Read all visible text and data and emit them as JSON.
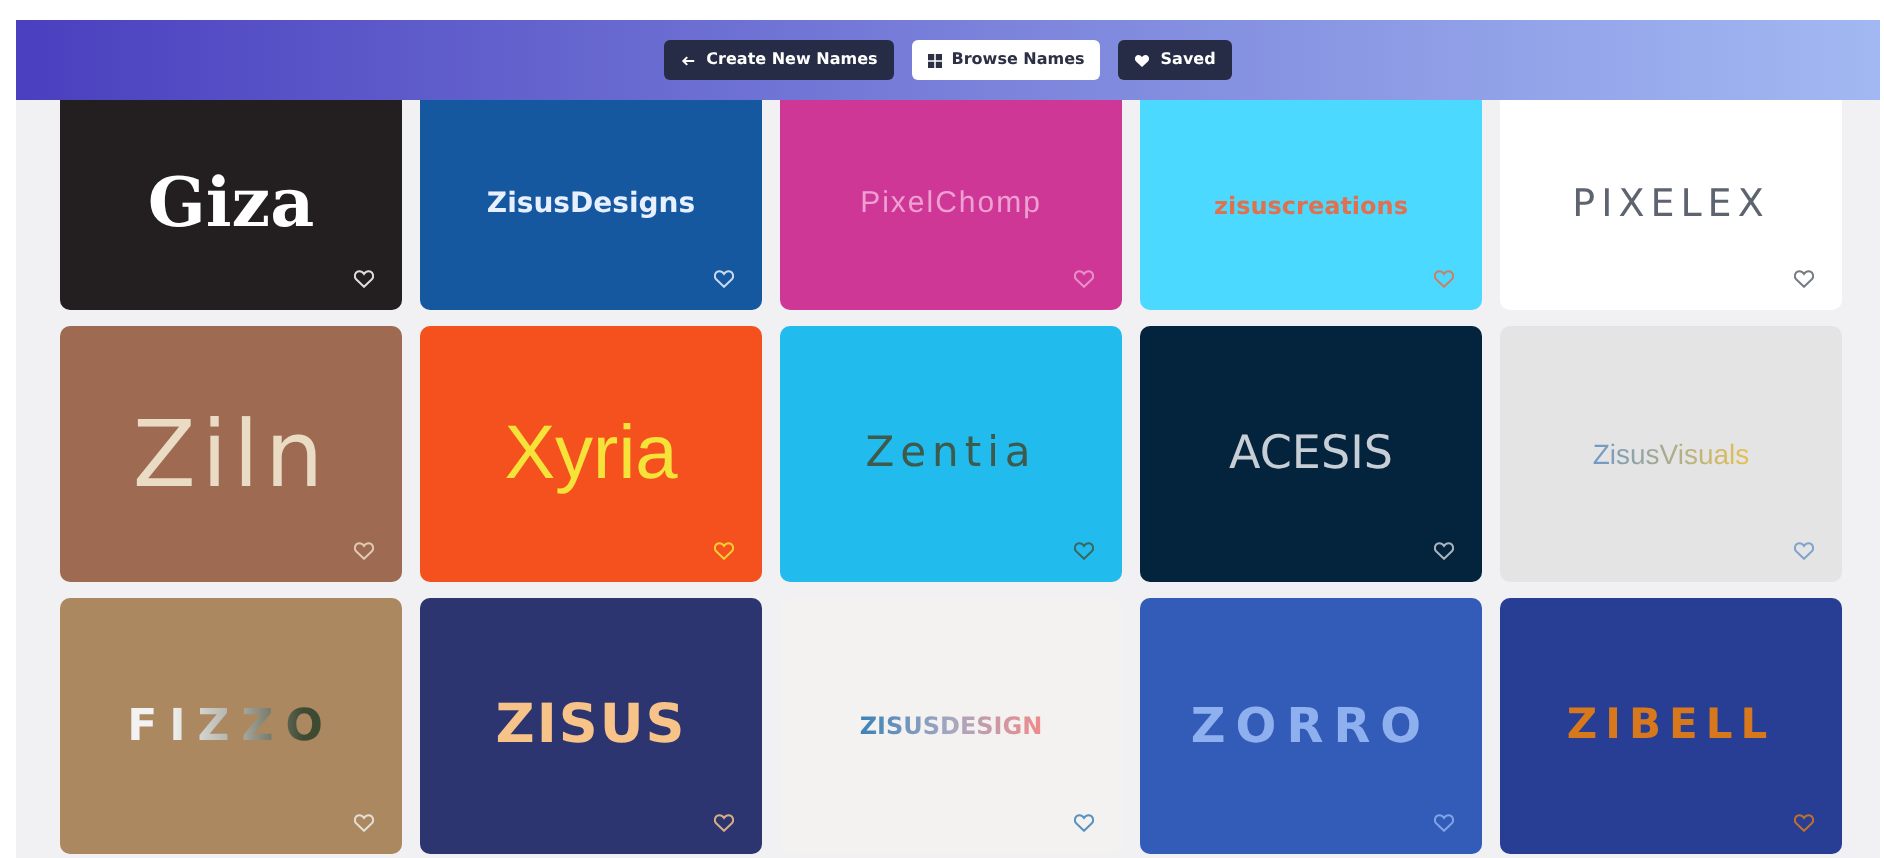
{
  "nav": [
    {
      "label": "Create New Names",
      "selected": false
    },
    {
      "label": "Browse Names",
      "selected": true
    },
    {
      "label": "Saved",
      "selected": false
    }
  ],
  "names": [
    {
      "name": "Giza",
      "saved": false
    },
    {
      "name": "ZisusDesigns",
      "saved": false
    },
    {
      "name": "PixelChomp",
      "saved": false
    },
    {
      "name": "zisuscreations",
      "saved": false
    },
    {
      "name": "PIXELEX",
      "saved": false
    },
    {
      "name": "Ziln",
      "saved": false
    },
    {
      "name": "Xyria",
      "saved": false
    },
    {
      "name": "Zentia",
      "saved": false
    },
    {
      "name": "ACESIS",
      "saved": false
    },
    {
      "name": "ZisusVisuals",
      "saved": false
    },
    {
      "name": "FIZZO",
      "saved": false
    },
    {
      "name": "ZISUS",
      "saved": false
    },
    {
      "name": "ZISUSDESIGN",
      "saved": false
    },
    {
      "name": "ZORRO",
      "saved": false
    },
    {
      "name": "ZIBELL",
      "saved": false
    }
  ]
}
